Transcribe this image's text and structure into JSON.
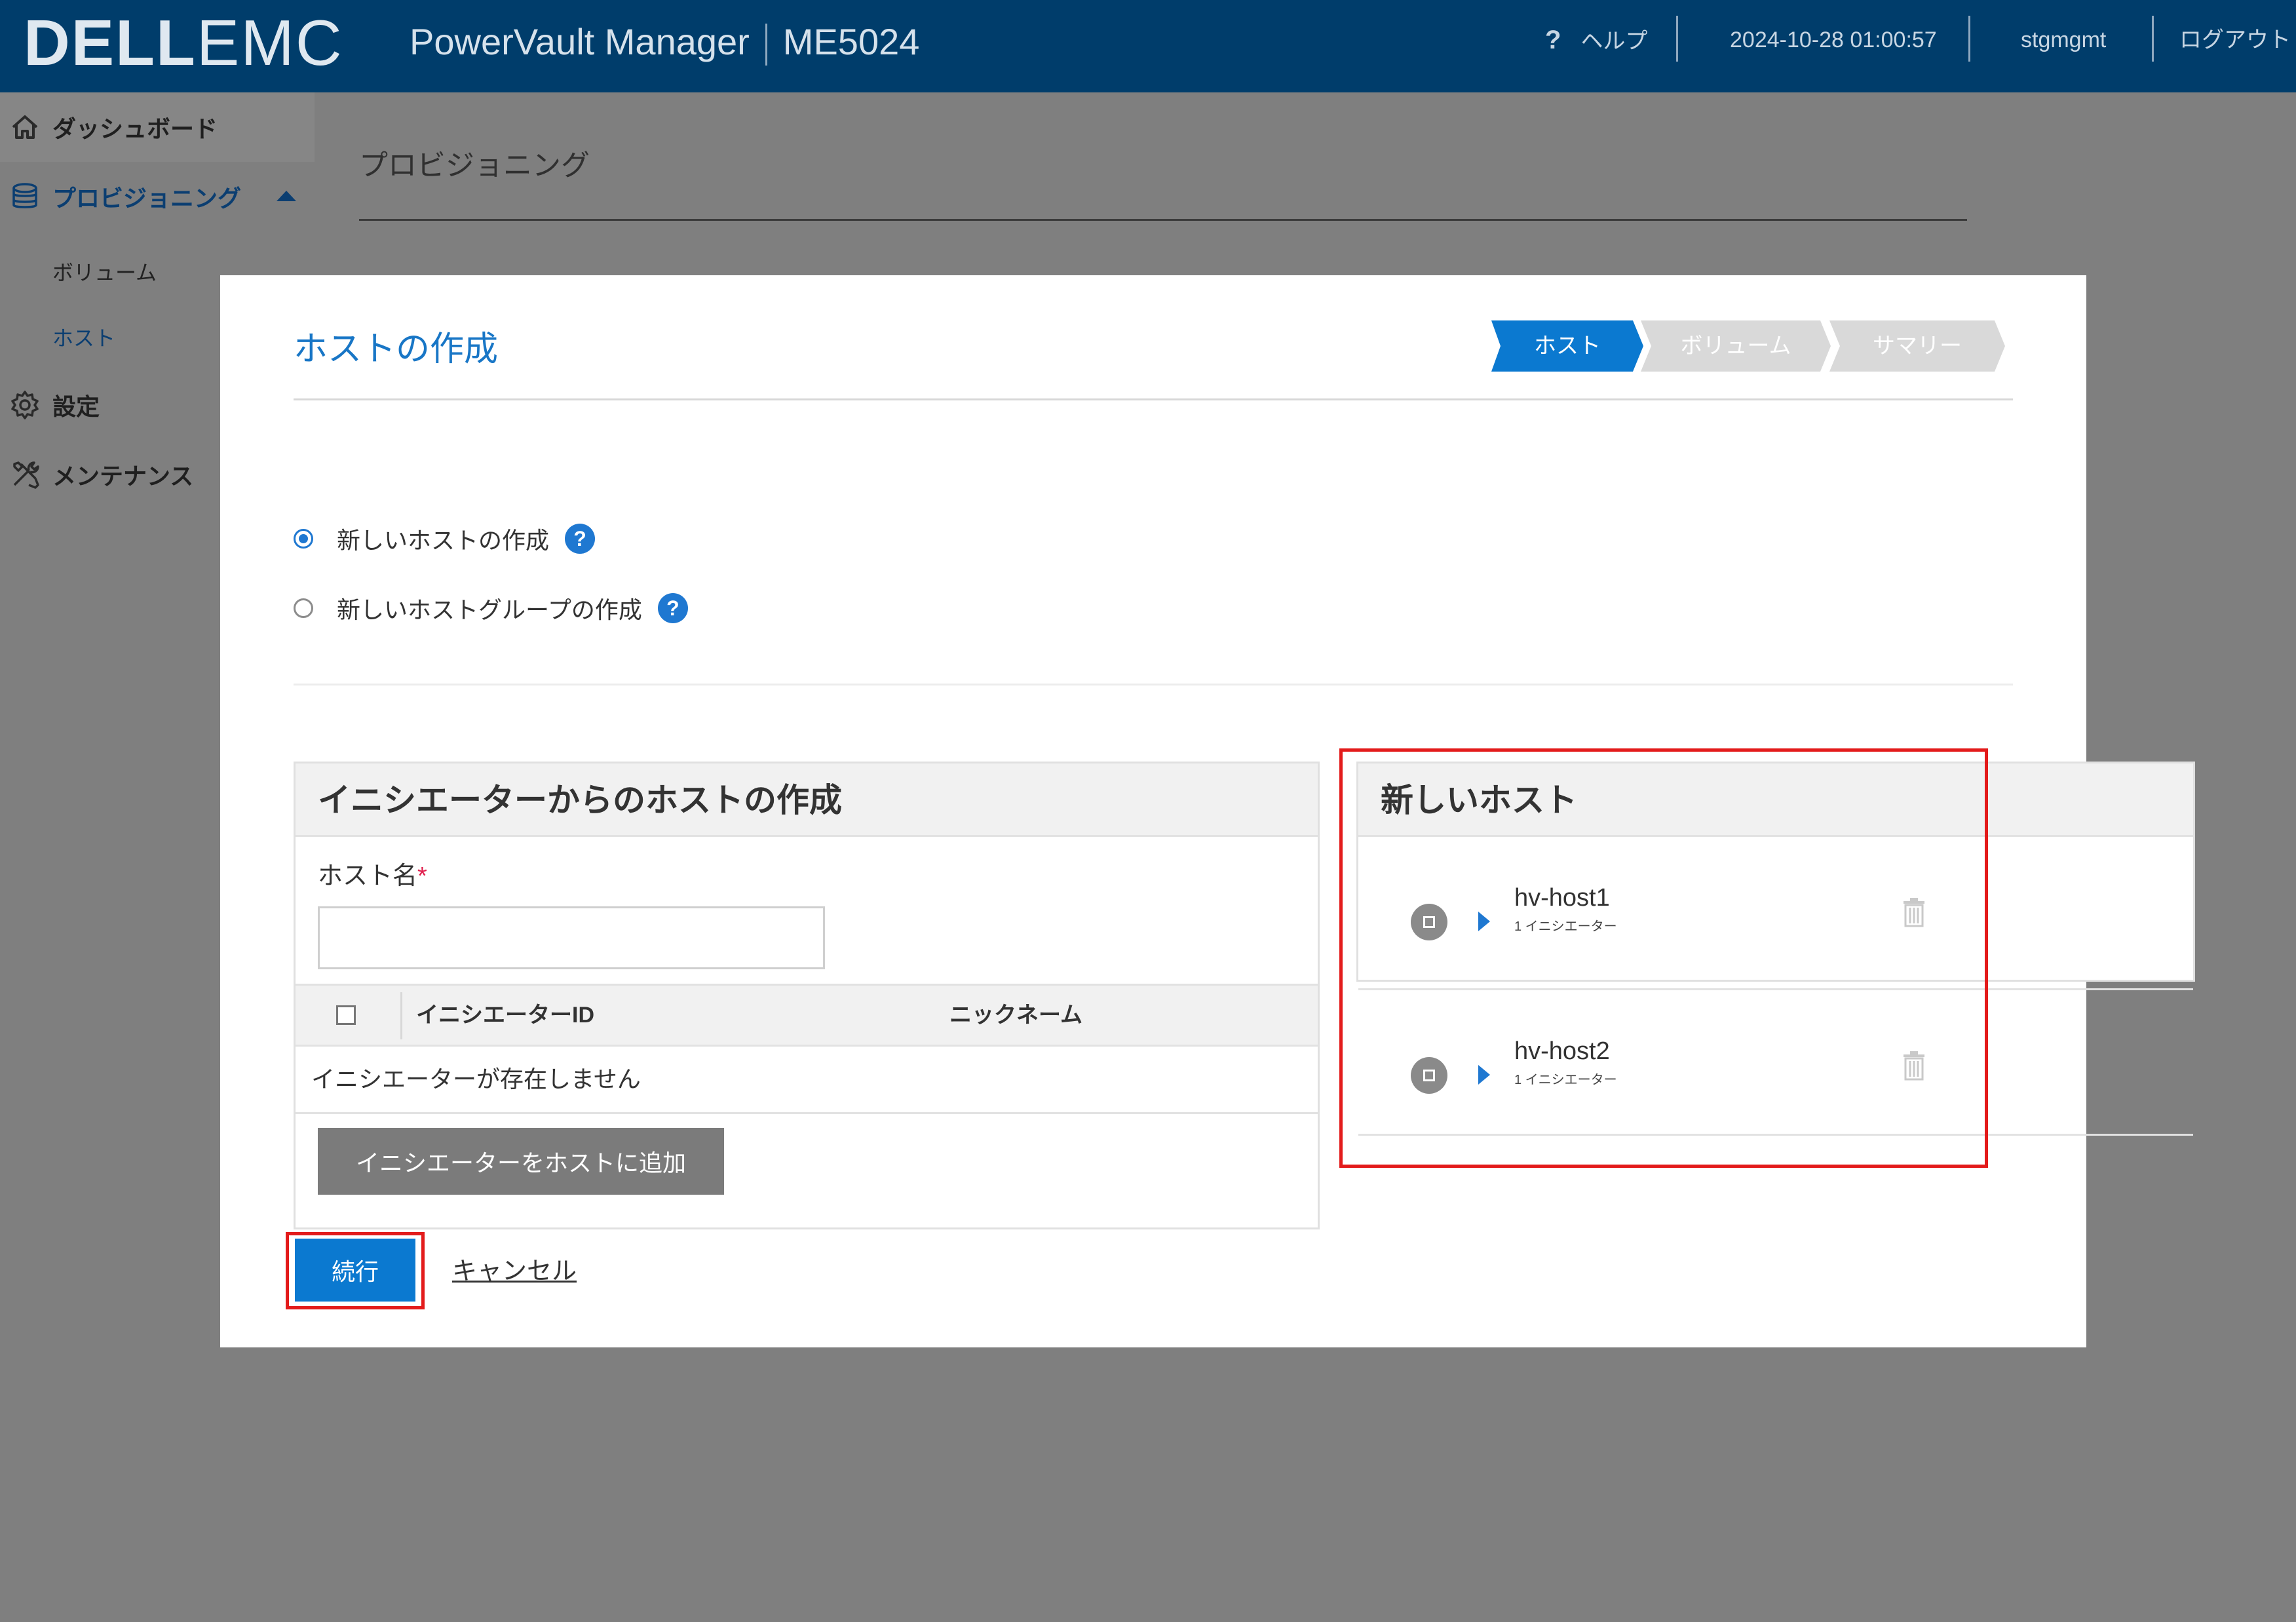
{
  "header": {
    "logo_bold": "DELL",
    "logo_light": "EMC",
    "product": "PowerVault Manager",
    "model": "ME5024",
    "help": "ヘルプ",
    "help_symbol": "?",
    "datetime": "2024-10-28 01:00:57",
    "user": "stgmgmt",
    "logout": "ログアウト"
  },
  "sidebar": {
    "items": [
      {
        "label": "ダッシュボード",
        "icon": "home-icon"
      },
      {
        "label": "プロビジョニング",
        "icon": "database-icon"
      },
      {
        "label": "設定",
        "icon": "gear-icon"
      },
      {
        "label": "メンテナンス",
        "icon": "tools-icon"
      }
    ],
    "sub_items": [
      {
        "label": "ボリューム"
      },
      {
        "label": "ホスト"
      }
    ]
  },
  "page": {
    "title": "プロビジョニング"
  },
  "modal": {
    "title": "ホストの作成",
    "steps": [
      {
        "label": "ホスト",
        "active": true
      },
      {
        "label": "ボリューム",
        "active": false
      },
      {
        "label": "サマリー",
        "active": false
      }
    ],
    "options": [
      {
        "label": "新しいホストの作成",
        "selected": true
      },
      {
        "label": "新しいホストグループの作成",
        "selected": false
      }
    ],
    "help_symbol": "?",
    "left_panel": {
      "title": "イニシエーターからのホストの作成",
      "host_name_label": "ホスト名",
      "required_mark": "*",
      "host_name_value": "",
      "columns": [
        "イニシエーターID",
        "ニックネーム"
      ],
      "empty_message": "イニシエーターが存在しません",
      "add_button": "イニシエーターをホストに追加"
    },
    "right_panel": {
      "title": "新しいホスト",
      "hosts": [
        {
          "name": "hv-host1",
          "sub": "1 イニシエーター"
        },
        {
          "name": "hv-host2",
          "sub": "1 イニシエーター"
        }
      ]
    },
    "continue_button": "続行",
    "cancel_link": "キャンセル"
  },
  "colors": {
    "header_bg": "#003d6b",
    "accent": "#1f78d1",
    "highlight": "#e31b1b"
  }
}
